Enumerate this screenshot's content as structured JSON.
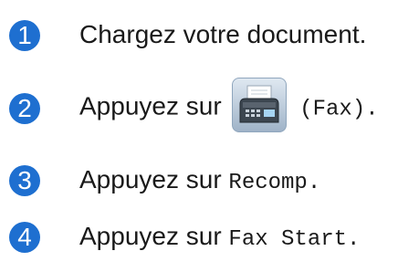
{
  "accent_color": "#1e6fd0",
  "steps": [
    {
      "number": "1",
      "text": "Chargez votre document."
    },
    {
      "number": "2",
      "prefix": "Appuyez sur",
      "icon": "fax-machine-icon",
      "suffix": "(Fax)."
    },
    {
      "number": "3",
      "prefix": "Appuyez sur",
      "code": "Recomp."
    },
    {
      "number": "4",
      "prefix": "Appuyez sur",
      "code": "Fax Start."
    }
  ]
}
